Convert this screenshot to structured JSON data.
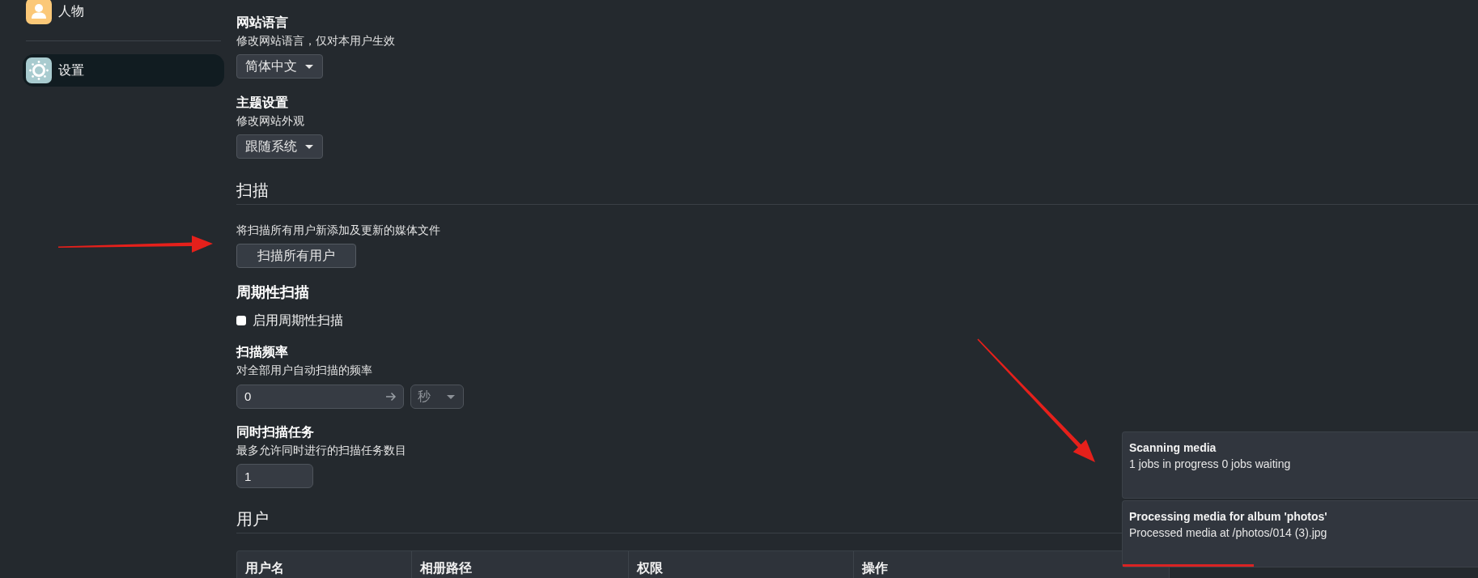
{
  "sidebar": {
    "groups": [
      [
        {
          "kind": "people",
          "label": "人物",
          "color": "#fbc878",
          "selected": false
        }
      ],
      [
        {
          "kind": "settings",
          "label": "设置",
          "color": "#a8cbcf",
          "selected": true
        }
      ]
    ]
  },
  "general_settings": [
    {
      "title": "网站语言",
      "description": "修改网站语言，仅对本用户生效",
      "value": "简体中文"
    },
    {
      "title": "主题设置",
      "description": "修改网站外观",
      "value": "跟随系统"
    }
  ],
  "scanner": {
    "heading": "扫描",
    "description": "将扫描所有用户新添加及更新的媒体文件",
    "button": "扫描所有用户",
    "periodic": {
      "heading": "周期性扫描",
      "checkbox": {
        "label": "启用周期性扫描",
        "checked": false
      },
      "interval": {
        "title": "扫描频率",
        "description": "对全部用户自动扫描的频率",
        "value": "0",
        "unit": {
          "value": "秒",
          "disabled": true
        }
      }
    },
    "concurrent": {
      "title": "同时扫描任务",
      "description": "最多允许同时进行的扫描任务数目",
      "value": "1"
    }
  },
  "users": {
    "heading": "用户",
    "table": {
      "columns": [
        "用户名",
        "相册路径",
        "权限",
        "操作"
      ]
    }
  },
  "notifications": [
    {
      "title": "Scanning media",
      "message": "1 jobs in progress 0 jobs waiting"
    },
    {
      "title": "Processing media for album 'photos'",
      "message": "Processed media at /photos/014 (3).jpg",
      "progress": {
        "level": 0.37
      }
    }
  ]
}
